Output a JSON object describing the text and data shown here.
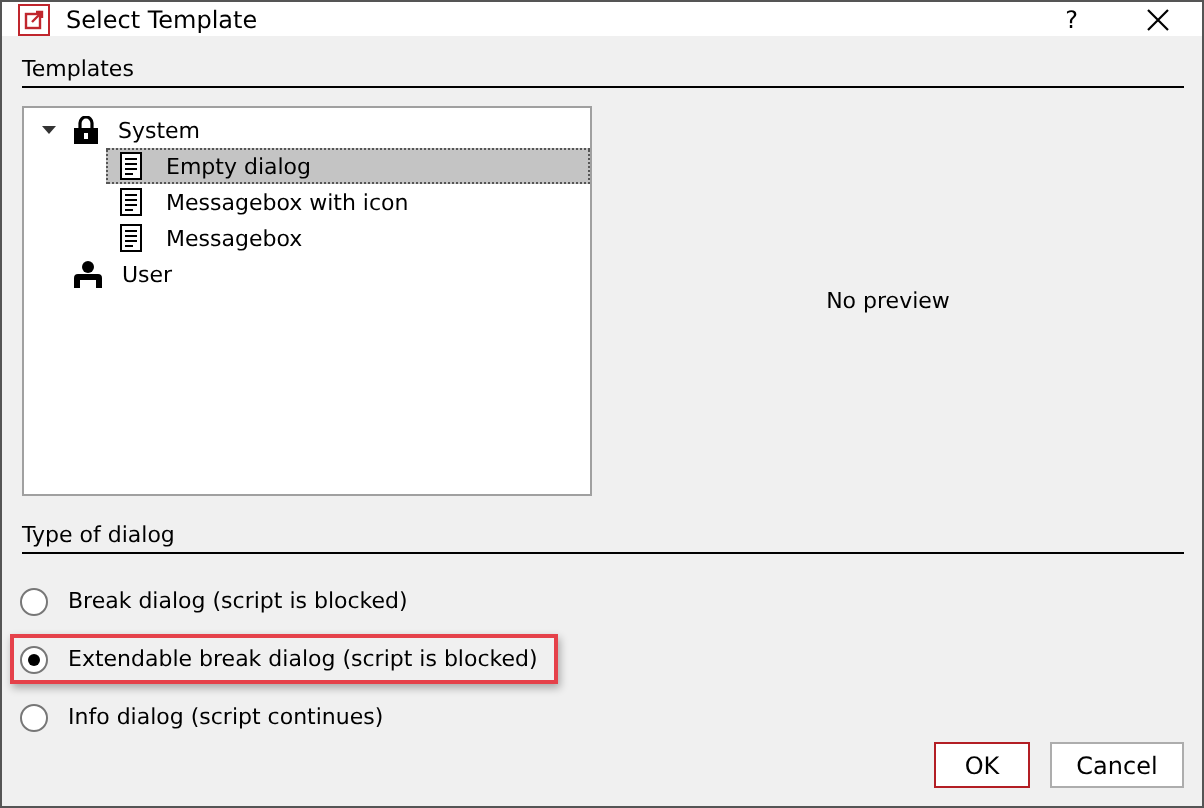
{
  "window": {
    "title": "Select Template",
    "help": "?"
  },
  "templates": {
    "heading": "Templates",
    "tree": [
      {
        "label": "System",
        "kind": "locked",
        "expanded": true,
        "selected": false,
        "children": [
          {
            "label": "Empty dialog",
            "selected": true
          },
          {
            "label": "Messagebox with icon",
            "selected": false
          },
          {
            "label": "Messagebox",
            "selected": false
          }
        ]
      },
      {
        "label": "User",
        "kind": "user",
        "selected": false
      }
    ],
    "preview": "No preview"
  },
  "dialog_type": {
    "heading": "Type of dialog",
    "options": [
      {
        "label": "Break dialog (script is blocked)",
        "selected": false,
        "highlighted": false
      },
      {
        "label": "Extendable break dialog (script is blocked)",
        "selected": true,
        "highlighted": true
      },
      {
        "label": "Info dialog (script continues)",
        "selected": false,
        "highlighted": false
      }
    ]
  },
  "buttons": [
    {
      "label": "OK",
      "default": true
    },
    {
      "label": "Cancel",
      "default": false
    }
  ]
}
